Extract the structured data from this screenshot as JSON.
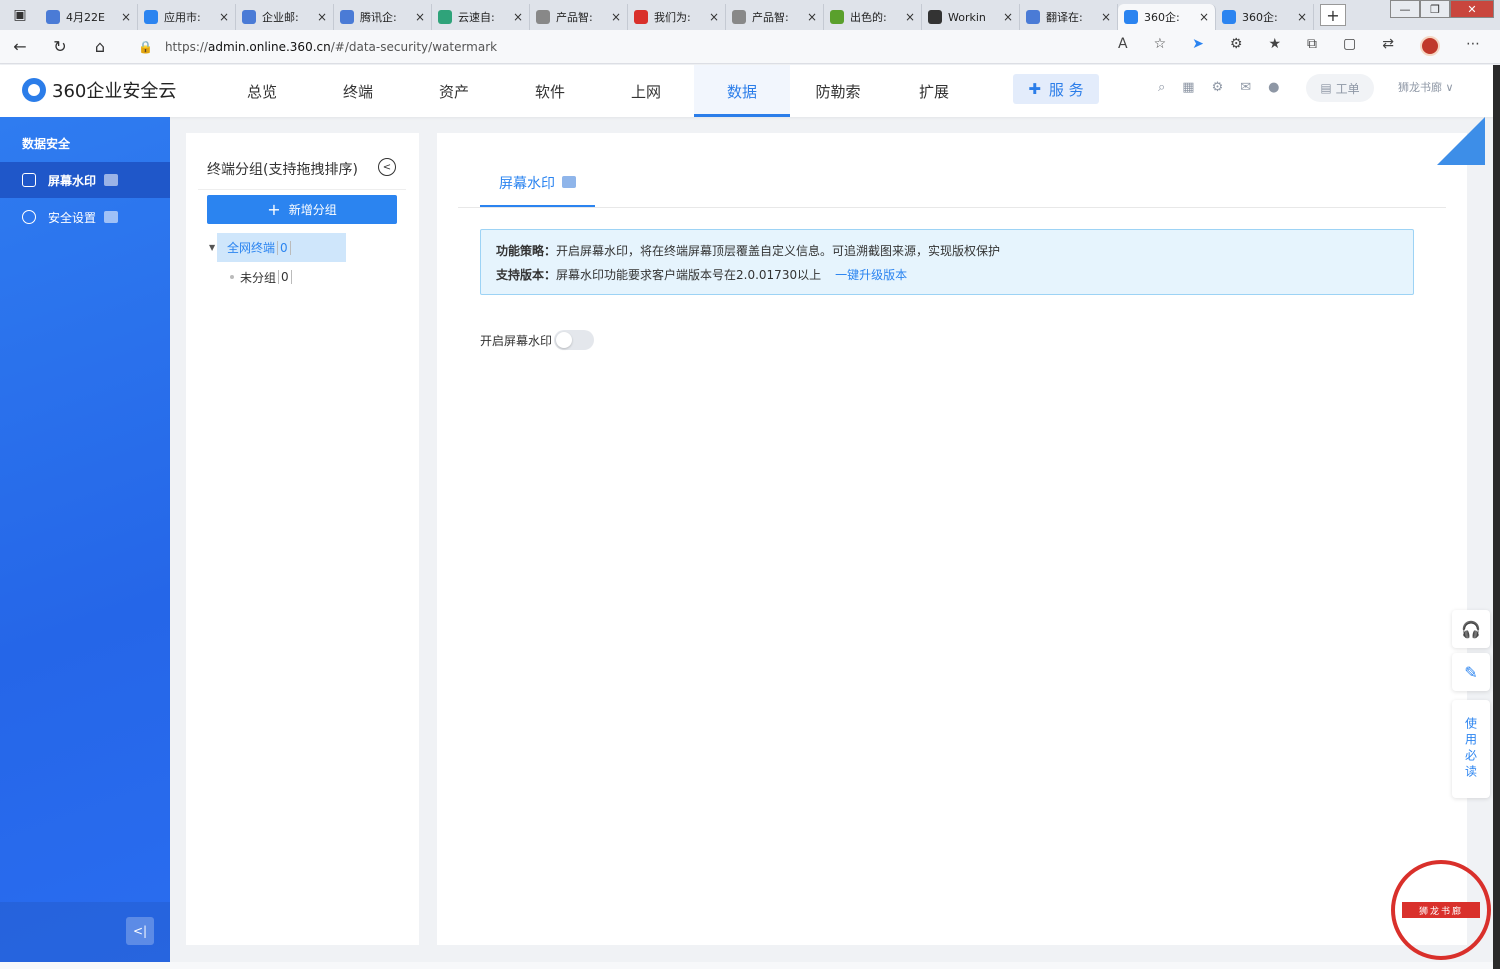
{
  "browser": {
    "tabs": [
      {
        "title": "4月22E",
        "color": "#4a7bd6"
      },
      {
        "title": "应用市:",
        "color": "#2b84f0"
      },
      {
        "title": "企业邮:",
        "color": "#4a7bd6"
      },
      {
        "title": "腾讯企:",
        "color": "#4a7bd6"
      },
      {
        "title": "云速自:",
        "color": "#2fa37a"
      },
      {
        "title": "产品智:",
        "color": "#888888"
      },
      {
        "title": "我们为:",
        "color": "#d9302b"
      },
      {
        "title": "产品智:",
        "color": "#888888"
      },
      {
        "title": "出色的:",
        "color": "#5aa02c"
      },
      {
        "title": "Workin",
        "color": "#333333"
      },
      {
        "title": "翻译在:",
        "color": "#4a7bd6"
      },
      {
        "title": "360企:",
        "color": "#2b84f0"
      },
      {
        "title": "360企:",
        "color": "#2b84f0"
      }
    ],
    "active_tab_index": 11,
    "url_prefix": "https://",
    "url_host": "admin.online.360.cn",
    "url_path": "/#/data-security/watermark"
  },
  "header": {
    "logo_text": "360企业安全云",
    "nav": [
      "总览",
      "终端",
      "资产",
      "软件",
      "上网",
      "数据",
      "防勒索",
      "扩展"
    ],
    "active_nav": "数据",
    "service_label": "服 务",
    "ticket_label": "工单",
    "user_name": "狮龙书廊 ∨"
  },
  "sidebar": {
    "title": "数据安全",
    "items": [
      {
        "label": "屏幕水印",
        "active": true
      },
      {
        "label": "安全设置",
        "active": false
      }
    ],
    "collapse_label": "<|"
  },
  "group_panel": {
    "title": "终端分组(支持拖拽排序)",
    "add_label": "新增分组",
    "root": {
      "label": "全网终端",
      "count": "0"
    },
    "children": [
      {
        "label": "未分组",
        "count": "0"
      }
    ]
  },
  "content": {
    "tab_label": "屏幕水印",
    "policy_label": "功能策略：",
    "policy_text": "开启屏幕水印，将在终端屏幕顶层覆盖自定义信息。可追溯截图来源，实现版权保护",
    "version_label": "支持版本：",
    "version_text": "屏幕水印功能要求客户端版本号在2.0.01730以上",
    "upgrade_link": "一键升级版本",
    "toggle_label": "开启屏幕水印",
    "toggle_on": false
  },
  "float": {
    "read_label": "使用必读"
  },
  "colors": {
    "accent": "#2b84f0",
    "sidebar": "#2566e8",
    "info_bg": "#e6f4fd"
  }
}
